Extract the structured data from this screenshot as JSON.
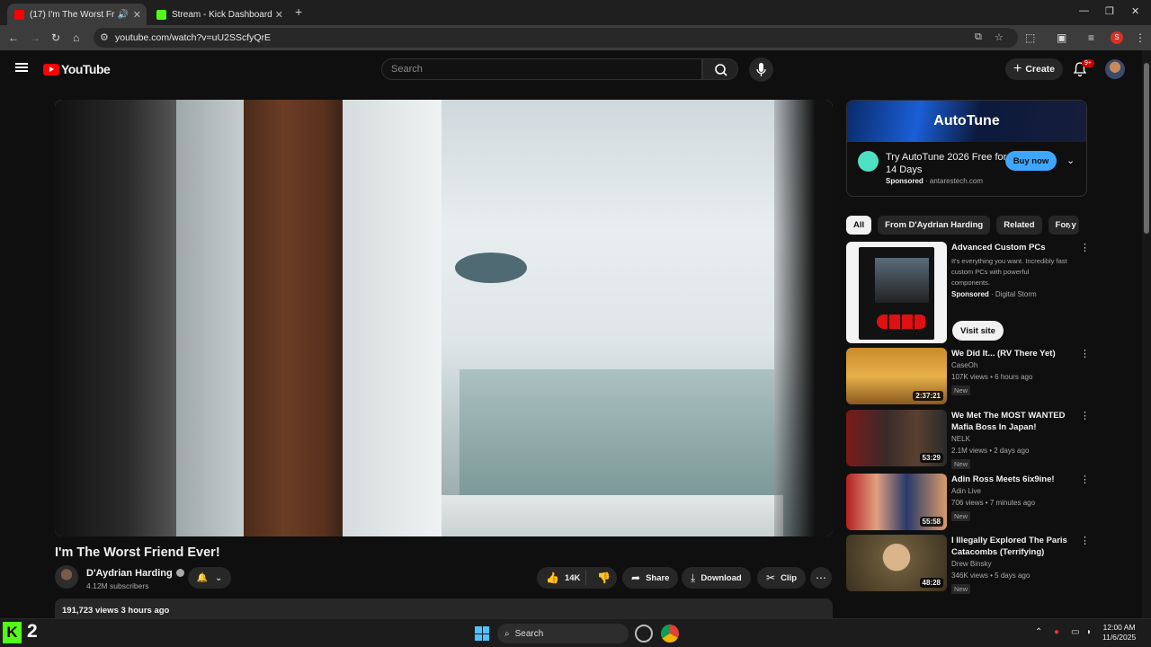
{
  "browser": {
    "tabs": [
      {
        "title": "(17) I'm The Worst Friend E",
        "active": true,
        "favicon": "youtube-favicon-icon"
      },
      {
        "title": "Stream - Kick Dashboard",
        "active": false,
        "favicon": "kick-favicon-icon"
      }
    ],
    "url": "youtube.com/watch?v=uU2SScfyQrE"
  },
  "youtube": {
    "logo_text": "YouTube",
    "search_placeholder": "Search",
    "create_label": "Create",
    "notification_badge": "9+"
  },
  "video": {
    "title": "I'm The Worst Friend Ever!",
    "channel": "D'Aydrian Harding",
    "subscribers": "4.12M subscribers",
    "likes": "14K",
    "share_label": "Share",
    "download_label": "Download",
    "clip_label": "Clip",
    "views_date": "191,723 views  3 hours ago"
  },
  "ad": {
    "banner_text": "AutoTune",
    "title": "Try AutoTune 2026 Free for 14 Days",
    "sponsored": "Sponsored",
    "domain": "antarestech.com",
    "button": "Buy now"
  },
  "chips": [
    "All",
    "From D'Aydrian Harding",
    "Related",
    "For y"
  ],
  "recommendations": [
    {
      "title": "Advanced Custom PCs",
      "desc": "It's everything you want. Incredibly fast custom PCs with powerful components.",
      "sponsored": "Sponsored",
      "advertiser": "Digital Storm",
      "button": "Visit site"
    },
    {
      "title": "We Did It... (RV There Yet)",
      "channel": "CaseOh",
      "meta": "107K views • 6 hours ago",
      "badge": "New",
      "duration": "2:37:21"
    },
    {
      "title": "We Met The MOST WANTED Mafia Boss In Japan!",
      "channel": "NELK",
      "meta": "2.1M views • 2 days ago",
      "badge": "New",
      "duration": "53:29"
    },
    {
      "title": "Adin Ross Meets 6ix9ine!",
      "channel": "Adin Live",
      "meta": "706 views • 7 minutes ago",
      "badge": "New",
      "duration": "55:58"
    },
    {
      "title": "I Illegally Explored The Paris Catacombs (Terrifying)",
      "channel": "Drew Binsky",
      "meta": "346K views • 5 days ago",
      "badge": "New",
      "duration": "48:28"
    }
  ],
  "taskbar": {
    "kick_count": "2",
    "search_label": "Search",
    "time": "12:00 AM",
    "date": "11/6/2025"
  }
}
